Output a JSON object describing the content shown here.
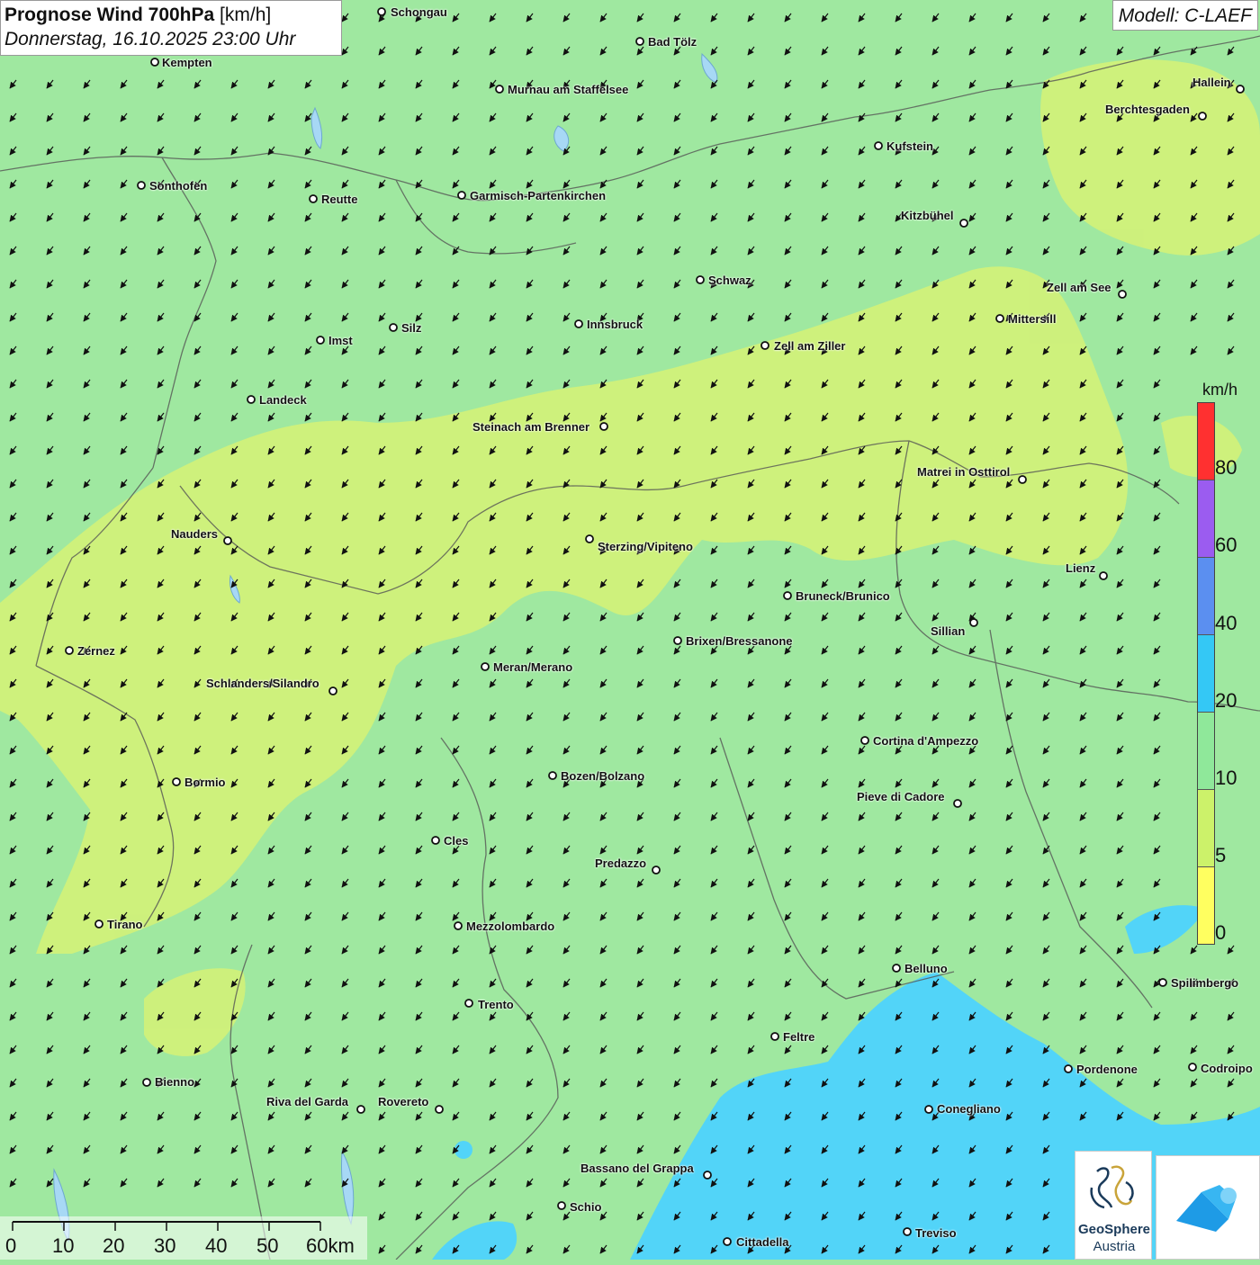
{
  "title": {
    "main": "Prognose Wind 700hPa",
    "unit": "[km/h]",
    "datetime": "Donnerstag, 16.10.2025 23:00 Uhr"
  },
  "model": "Modell: C-LAEF",
  "legend": {
    "unit": "km/h",
    "ticks": [
      "80",
      "60",
      "40",
      "20",
      "10",
      "5",
      "0"
    ],
    "colors": [
      "#ff3030",
      "#9b5cf0",
      "#5b8ff0",
      "#34c8f5",
      "#8fe89a",
      "#ccf26a",
      "#ffff60"
    ]
  },
  "map_colors": {
    "calm_band": "#d6f276",
    "base_green": "#9fe8a0",
    "fast_blue": "#52d4f8"
  },
  "wind": {
    "direction": "from north-east",
    "arrow_icon": "wind-arrow-icon"
  },
  "scale_bar": {
    "labels": [
      "0",
      "10",
      "20",
      "30",
      "40",
      "50",
      "60km"
    ]
  },
  "cities": [
    {
      "name": "Schongau"
    },
    {
      "name": "Bad Tölz"
    },
    {
      "name": "Kempten"
    },
    {
      "name": "Murnau am Staffelsee"
    },
    {
      "name": "Hallein"
    },
    {
      "name": "Berchtesgaden"
    },
    {
      "name": "Kufstein"
    },
    {
      "name": "Sonthofen"
    },
    {
      "name": "Reutte"
    },
    {
      "name": "Garmisch-Partenkirchen"
    },
    {
      "name": "Kitzbühel"
    },
    {
      "name": "Schwaz"
    },
    {
      "name": "Zell am See"
    },
    {
      "name": "Mittersill"
    },
    {
      "name": "Silz"
    },
    {
      "name": "Innsbruck"
    },
    {
      "name": "Imst"
    },
    {
      "name": "Zell am Ziller"
    },
    {
      "name": "Landeck"
    },
    {
      "name": "Steinach am Brenner"
    },
    {
      "name": "Matrei in Osttirol"
    },
    {
      "name": "Nauders"
    },
    {
      "name": "Sterzing/Vipiteno"
    },
    {
      "name": "Lienz"
    },
    {
      "name": "Bruneck/Brunico"
    },
    {
      "name": "Sillian"
    },
    {
      "name": "Zernez"
    },
    {
      "name": "Brixen/Bressanone"
    },
    {
      "name": "Meran/Merano"
    },
    {
      "name": "Schlanders/Silandro"
    },
    {
      "name": "Cortina d'Ampezzo"
    },
    {
      "name": "Bozen/Bolzano"
    },
    {
      "name": "Bormio"
    },
    {
      "name": "Pieve di Cadore"
    },
    {
      "name": "Cles"
    },
    {
      "name": "Predazzo"
    },
    {
      "name": "Tirano"
    },
    {
      "name": "Mezzolombardo"
    },
    {
      "name": "Belluno"
    },
    {
      "name": "Spilimbergo"
    },
    {
      "name": "Trento"
    },
    {
      "name": "Feltre"
    },
    {
      "name": "Pordenone"
    },
    {
      "name": "Codroipo"
    },
    {
      "name": "Bienno"
    },
    {
      "name": "Riva del Garda"
    },
    {
      "name": "Rovereto"
    },
    {
      "name": "Conegliano"
    },
    {
      "name": "Bassano del Grappa"
    },
    {
      "name": "Schio"
    },
    {
      "name": "Treviso"
    },
    {
      "name": "Cittadella"
    }
  ],
  "logos": {
    "geosphere_line1": "GeoSphere",
    "geosphere_line2": "Austria"
  }
}
